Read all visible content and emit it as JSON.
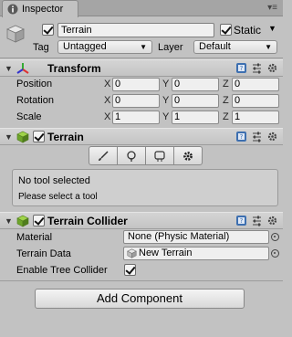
{
  "tab": {
    "title": "Inspector"
  },
  "header": {
    "name": "Terrain",
    "static_label": "Static",
    "tag_label": "Tag",
    "tag_value": "Untagged",
    "layer_label": "Layer",
    "layer_value": "Default"
  },
  "transform": {
    "title": "Transform",
    "rows": [
      {
        "label": "Position",
        "x": "0",
        "y": "0",
        "z": "0"
      },
      {
        "label": "Rotation",
        "x": "0",
        "y": "0",
        "z": "0"
      },
      {
        "label": "Scale",
        "x": "1",
        "y": "1",
        "z": "1"
      }
    ],
    "axes": [
      "X",
      "Y",
      "Z"
    ]
  },
  "terrain": {
    "title": "Terrain",
    "tools": [
      "paint-brush-icon",
      "tree-icon",
      "detail-icon",
      "settings-icon"
    ],
    "help_title": "No tool selected",
    "help_text": "Please select a tool"
  },
  "collider": {
    "title": "Terrain Collider",
    "material_label": "Material",
    "material_value": "None (Physic Material)",
    "terrain_data_label": "Terrain Data",
    "terrain_data_value": "New Terrain",
    "tree_collider_label": "Enable Tree Collider"
  },
  "add_component": "Add Component"
}
